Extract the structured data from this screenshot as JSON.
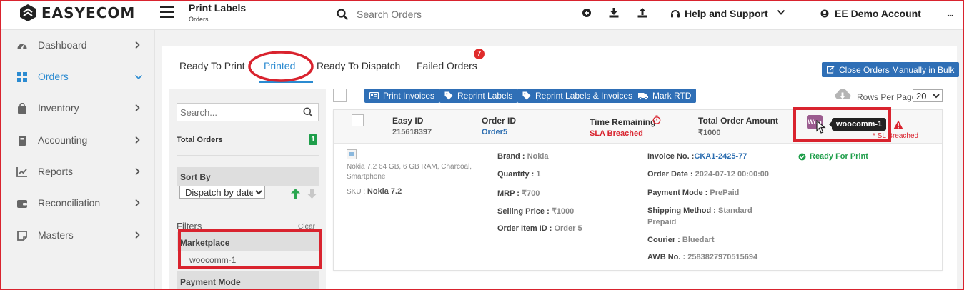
{
  "app": {
    "name": "EASYECOM"
  },
  "header": {
    "title": "Print Labels",
    "subtitle": "Orders",
    "search_placeholder": "Search Orders",
    "help_label": "Help and Support",
    "account_label": "EE Demo Account",
    "more_label": "..."
  },
  "sidebar": {
    "items": [
      {
        "label": "Dashboard",
        "icon": "gauge-icon"
      },
      {
        "label": "Orders",
        "icon": "grid-icon",
        "active": true
      },
      {
        "label": "Inventory",
        "icon": "bag-icon"
      },
      {
        "label": "Accounting",
        "icon": "ledger-icon"
      },
      {
        "label": "Reports",
        "icon": "chart-icon"
      },
      {
        "label": "Reconciliation",
        "icon": "wallet-icon"
      },
      {
        "label": "Masters",
        "icon": "note-icon"
      }
    ]
  },
  "tabs": [
    {
      "label": "Ready To Print"
    },
    {
      "label": "Printed",
      "active": true
    },
    {
      "label": "Ready To Dispatch"
    },
    {
      "label": "Failed Orders",
      "badge": "7"
    }
  ],
  "actions": {
    "close_bulk": "Close Orders Manually in Bulk",
    "print_invoices": "Print Invoices",
    "reprint_labels": "Reprint Labels",
    "reprint_labels_invoices": "Reprint Labels & Invoices",
    "mark_rtd": "Mark RTD",
    "rows_per_page_label": "Rows Per Page",
    "rows_per_page_value": "20"
  },
  "filters": {
    "search_placeholder": "Search...",
    "total_orders_label": "Total Orders",
    "total_orders_count": "1",
    "sort_by_label": "Sort By",
    "sort_by_value": "Dispatch by date",
    "filters_label": "Filters",
    "clear_label": "Clear",
    "marketplace_label": "Marketplace",
    "marketplace_value": "woocomm-1",
    "payment_mode_label": "Payment Mode"
  },
  "order": {
    "easy_id_label": "Easy ID",
    "easy_id": "215618397",
    "order_id_label": "Order ID",
    "order_id": "Order5",
    "time_remaining_label": "Time Remaining",
    "time_remaining": "SLA Breached",
    "total_amount_label": "Total Order Amount",
    "total_amount": "₹1000",
    "marketplace_logo": "Woo",
    "tooltip": "woocomm-1",
    "sl_breached": "* SL Breached",
    "product_name": "Nokia 7.2 64 GB, 6 GB RAM, Charcoal, Smartphone",
    "sku_label": "SKU :",
    "sku": "Nokia 7.2",
    "brand_label": "Brand :",
    "brand": "Nokia",
    "quantity_label": "Quantity :",
    "quantity": "1",
    "mrp_label": "MRP :",
    "mrp": "₹700",
    "selling_price_label": "Selling Price :",
    "selling_price": "₹1000",
    "order_item_id_label": "Order Item ID :",
    "order_item_id": "Order 5",
    "invoice_label": "Invoice No. :",
    "invoice": "CKA1-2425-77",
    "order_date_label": "Order Date :",
    "order_date": "2024-07-12 00:00:00",
    "payment_mode_label": "Payment Mode :",
    "payment_mode": "PrePaid",
    "shipping_method_label": "Shipping Method :",
    "shipping_method_1": "Standard",
    "shipping_method_2": "Prepaid",
    "courier_label": "Courier :",
    "courier": "Bluedart",
    "awb_label": "AWB No. :",
    "awb": "2583827970515694",
    "status": "Ready For Print"
  },
  "colors": {
    "accent": "#2b8bd1",
    "button_blue": "#2f6fb6",
    "danger": "#d9232e",
    "success": "#1e9e4a",
    "woo_purple": "#9b5c8f"
  }
}
